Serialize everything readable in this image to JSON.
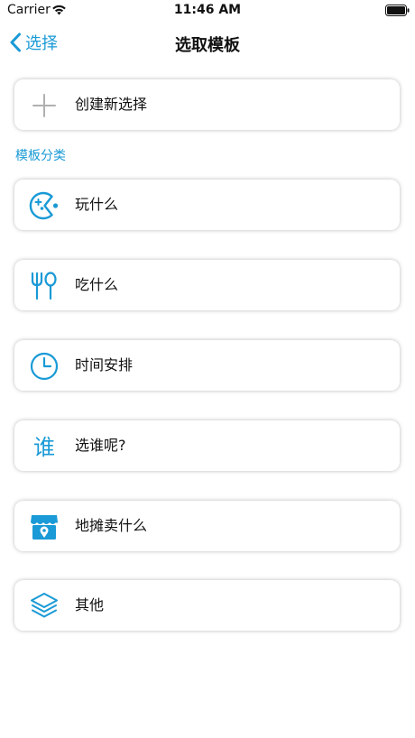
{
  "status_bar": {
    "carrier": "Carrier",
    "time": "11:46 AM",
    "wifi_icon": "wifi-icon",
    "battery_icon": "battery-icon"
  },
  "nav": {
    "back_label": "选择",
    "title": "选取模板",
    "back_icon": "chevron-left-icon"
  },
  "create": {
    "label": "创建新选择",
    "icon": "plus-icon"
  },
  "section": {
    "title": "模板分类"
  },
  "templates": [
    {
      "label": "玩什么",
      "icon": "pacman-game-icon"
    },
    {
      "label": "吃什么",
      "icon": "fork-spoon-icon"
    },
    {
      "label": "时间安排",
      "icon": "clock-icon"
    },
    {
      "label": "选谁呢?",
      "icon": "who-character-icon",
      "icon_char": "谁"
    },
    {
      "label": "地摊卖什么",
      "icon": "stall-shop-icon"
    },
    {
      "label": "其他",
      "icon": "layers-icon"
    }
  ],
  "colors": {
    "accent": "#1a9ad6",
    "text": "#111111",
    "plus_icon": "#b0b0b0",
    "background": "#ffffff"
  }
}
